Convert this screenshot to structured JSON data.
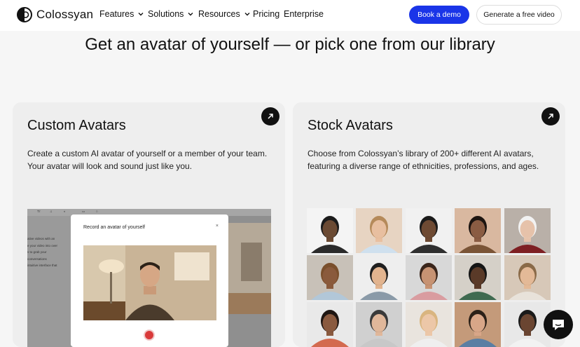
{
  "nav": {
    "logo_text": "Colossyan",
    "items": [
      {
        "label": "Features",
        "dropdown": true
      },
      {
        "label": "Solutions",
        "dropdown": true
      },
      {
        "label": "Resources",
        "dropdown": true
      },
      {
        "label": "Pricing",
        "dropdown": false
      },
      {
        "label": "Enterprise",
        "dropdown": false
      }
    ],
    "book_demo": "Book a demo",
    "generate_free": "Generate a free video"
  },
  "headline": "Get an avatar of yourself — or pick one from our library",
  "cards": {
    "custom": {
      "title": "Custom Avatars",
      "description": "Create a custom AI avatar of yourself or a member of your team. Your avatar will look and sound just like you.",
      "mock": {
        "toolbar_glyphs": [
          "Tт",
          "♫",
          "◐",
          "▭",
          "○"
        ],
        "sidebar_lines": [
          "ative videos with an",
          "e your video into over",
          "s to grab your",
          "conversations",
          "intuitive interface that"
        ],
        "modal_title": "Record an avatar of yourself",
        "modal_close": "×"
      }
    },
    "stock": {
      "title": "Stock Avatars",
      "description": "Choose from Colossyan’s library of 200+ different AI avatars, featuring a diverse range of ethnicities, professions, and ages."
    }
  },
  "colors": {
    "accent": "#1a35e8",
    "card_bg": "#eeeeee",
    "page_bg": "#f6f6f6",
    "record": "#d93a3a"
  }
}
